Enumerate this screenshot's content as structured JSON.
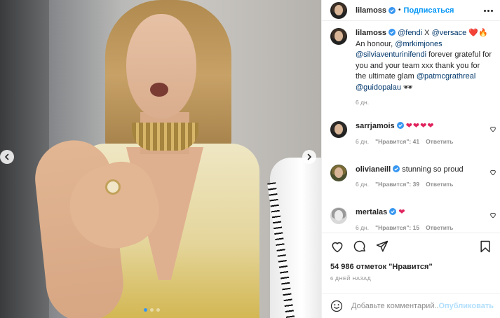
{
  "post": {
    "author": "lilamoss",
    "follow_label": "Подписаться",
    "separator": "•",
    "caption": {
      "username": "lilamoss",
      "parts": {
        "m1": "@fendi",
        "t1": " X ",
        "m2": "@versace",
        "emoji": " ❤️🔥 ",
        "t2": "An honour, ",
        "m3": "@mrkimjones",
        "t3": " ",
        "m4": "@silviaventurinifendi",
        "t4": " forever grateful for you and your team xxx thank you for the ultimate glam ",
        "m5": "@patmcgrathreal",
        "t5": " ",
        "m6": "@guidopalau",
        "t6": " 🕶"
      },
      "time": "6 дн."
    },
    "comments": [
      {
        "username": "sarrjamois",
        "text": "❤❤❤❤",
        "time": "6 дн.",
        "likes": "\"Нравится\": 41",
        "reply": "Ответить"
      },
      {
        "username": "olivianeill",
        "text": "stunning so proud",
        "time": "6 дн.",
        "likes": "\"Нравится\": 39",
        "reply": "Ответить"
      },
      {
        "username": "mertalas",
        "text": "❤",
        "time": "6 дн.",
        "likes": "\"Нравится\": 15",
        "reply": "Ответить"
      }
    ],
    "likes_count_text": "54 986 отметок \"Нравится\"",
    "date_text": "6 ДНЕЙ НАЗАД",
    "comment_placeholder": "Добавьте комментарий...",
    "publish_label": "Опубликовать",
    "carousel": {
      "total": 3,
      "active_index": 0
    }
  },
  "icons": {
    "like": "heart-icon",
    "comment": "comment-icon",
    "share": "share-icon",
    "save": "bookmark-icon",
    "more": "more-options-icon",
    "emoji": "smile-icon",
    "verified": "verified-badge-icon",
    "prev": "chevron-left-icon",
    "next": "chevron-right-icon"
  },
  "colors": {
    "link": "#00376b",
    "follow": "#0095f6",
    "verified": "#3897f0",
    "heart": "#e0245e",
    "muted": "#8e8e8e",
    "publish_disabled": "#b2dffc"
  }
}
